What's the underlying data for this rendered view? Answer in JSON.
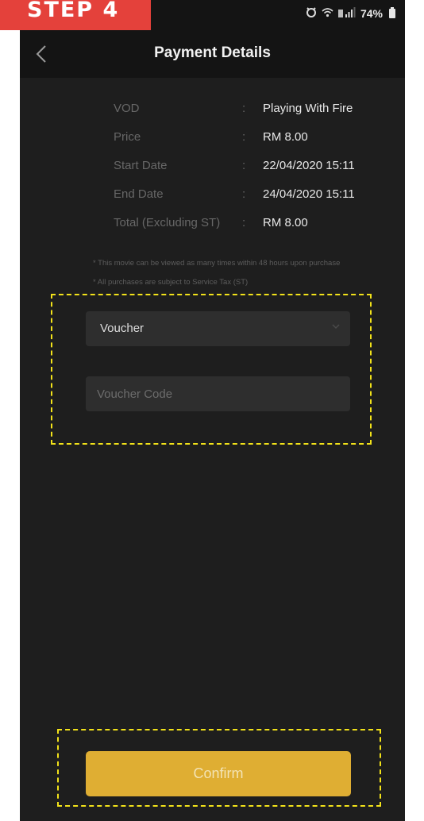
{
  "step_banner": "STEP 4",
  "status_bar": {
    "icons": [
      "alarm-icon",
      "wifi-icon",
      "signal-icon"
    ],
    "battery_percent": "74%"
  },
  "header": {
    "title": "Payment Details",
    "back_icon": "chevron-left-icon"
  },
  "details": [
    {
      "label": "VOD",
      "colon": ":",
      "value": "Playing With Fire"
    },
    {
      "label": "Price",
      "colon": ":",
      "value": "RM 8.00"
    },
    {
      "label": "Start Date",
      "colon": ":",
      "value": "22/04/2020 15:11"
    },
    {
      "label": "End Date",
      "colon": ":",
      "value": "24/04/2020 15:11"
    },
    {
      "label": "Total (Excluding ST)",
      "colon": ":",
      "value": "RM 8.00"
    }
  ],
  "notes": [
    "* This movie can be viewed as many times within 48 hours upon purchase",
    "* All purchases are subject to Service Tax (ST)"
  ],
  "payment": {
    "method_selected": "Voucher",
    "voucher_code_placeholder": "Voucher Code",
    "voucher_code_value": ""
  },
  "confirm_label": "Confirm",
  "colors": {
    "background": "#1e1e1e",
    "bar": "#141414",
    "field": "#2e2e2e",
    "confirm": "#dfae33",
    "highlight": "#f2e21a",
    "step_banner": "#e4413b"
  }
}
